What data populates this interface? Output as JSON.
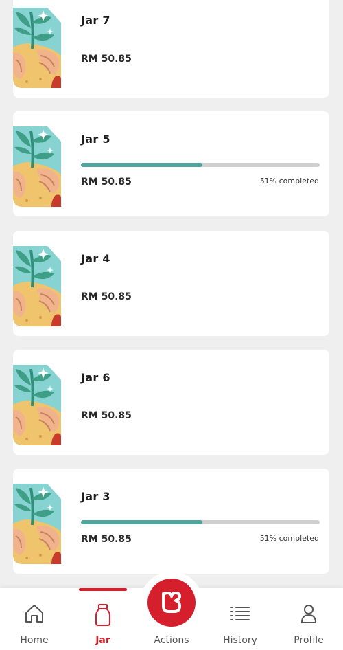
{
  "colors": {
    "accent": "#d61f2c",
    "progress": "#4ea69c",
    "track": "#cfcfcf"
  },
  "jars": [
    {
      "name": "Jar 7",
      "amount": "RM 50.85",
      "has_progress": false
    },
    {
      "name": "Jar 5",
      "amount": "RM 50.85",
      "has_progress": true,
      "progress": 0.51,
      "progress_text": "51% completed"
    },
    {
      "name": "Jar 4",
      "amount": "RM 50.85",
      "has_progress": false
    },
    {
      "name": "Jar 6",
      "amount": "RM 50.85",
      "has_progress": false
    },
    {
      "name": "Jar 3",
      "amount": "RM 50.85",
      "has_progress": true,
      "progress": 0.51,
      "progress_text": "51% completed"
    }
  ],
  "nav": {
    "items": [
      {
        "label": "Home",
        "icon": "home-icon"
      },
      {
        "label": "Jar",
        "icon": "jar-icon",
        "active": true
      },
      {
        "label": "Actions",
        "icon": "heart-icon"
      },
      {
        "label": "History",
        "icon": "list-icon"
      },
      {
        "label": "Profile",
        "icon": "person-icon"
      }
    ]
  }
}
